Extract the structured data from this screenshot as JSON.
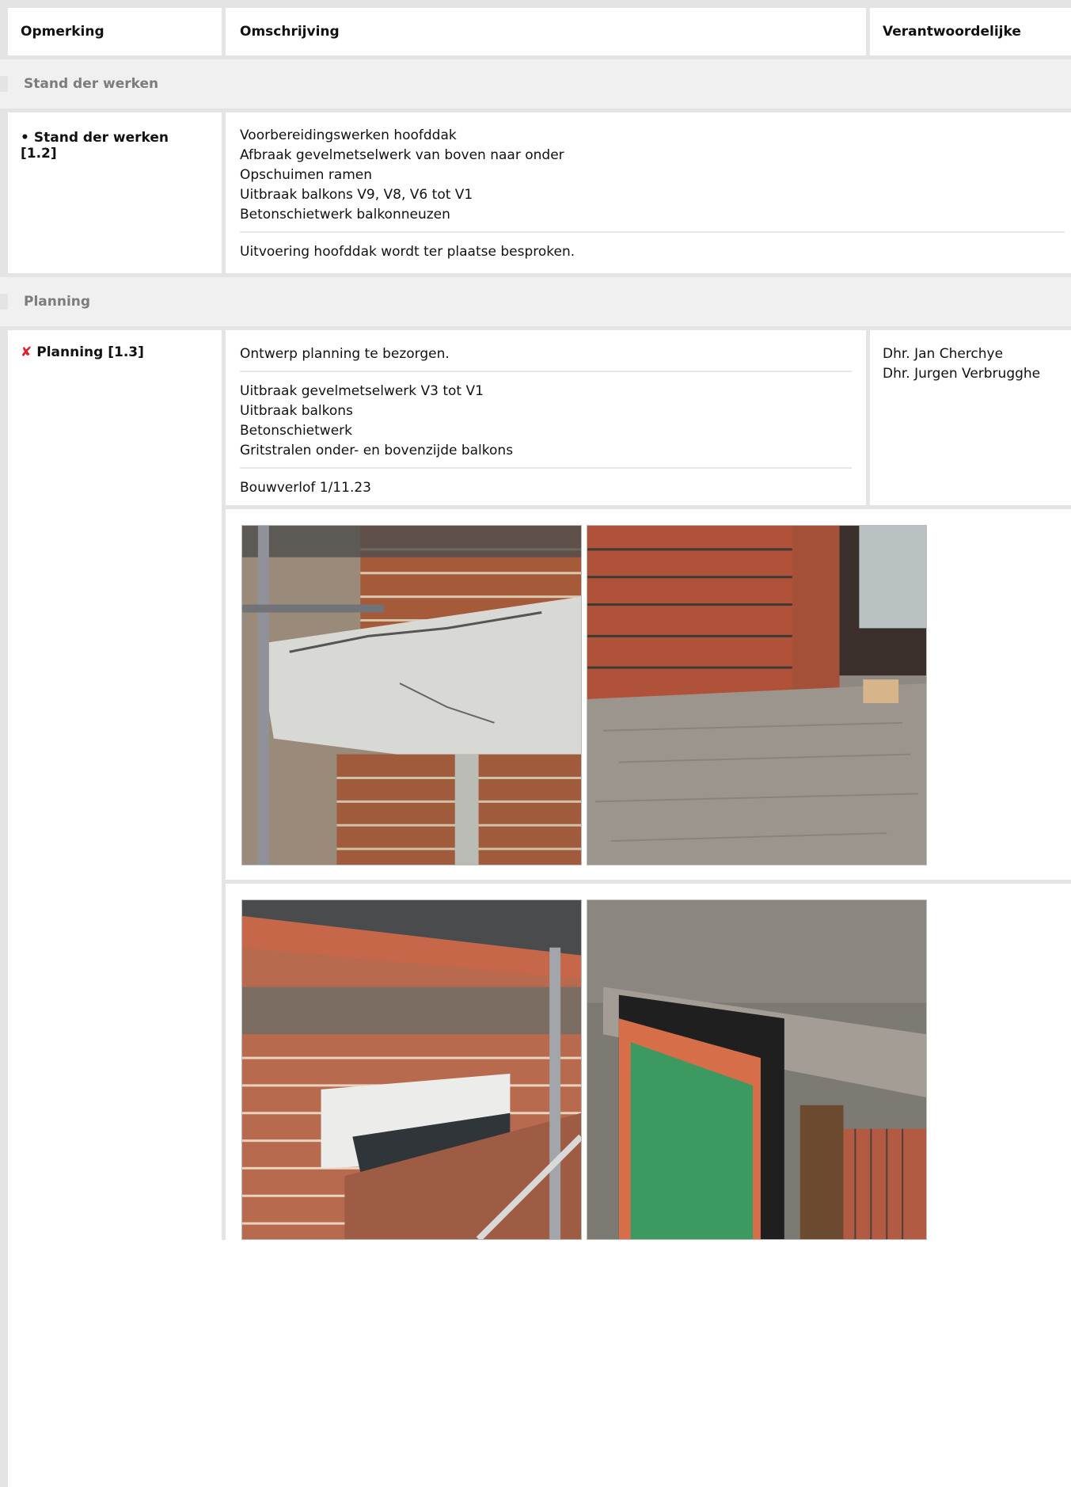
{
  "table": {
    "headers": {
      "opmerking": "Opmerking",
      "omschrijving": "Omschrijving",
      "verantwoordelijke": "Verantwoordelijke"
    }
  },
  "sections": [
    {
      "title": "Stand der werken",
      "item": {
        "bullet": "•",
        "label": "Stand der werken  [1.2]",
        "blocks": [
          [
            "Voorbereidingswerken hoofddak",
            "Afbraak gevelmetselwerk van boven naar onder",
            "Opschuimen ramen",
            "Uitbraak balkons V9, V8, V6 tot V1",
            "Betonschietwerk balkonneuzen"
          ],
          [
            "Uitvoering hoofddak wordt ter plaatse besproken."
          ]
        ]
      }
    },
    {
      "title": "Planning",
      "item": {
        "status_icon": "✘",
        "label": "Planning [1.3]",
        "blocks": [
          [
            "Ontwerp planning te bezorgen."
          ],
          [
            "Uitbraak gevelmetselwerk V3 tot V1",
            "Uitbraak balkons",
            "Betonschietwerk",
            "Gritstralen onder- en bovenzijde balkons"
          ],
          [
            "Bouwverlof 1/11.23"
          ]
        ],
        "responsible": [
          "Dhr. Jan Cherchye",
          "Dhr. Jurgen Verbrugghe"
        ]
      }
    }
  ],
  "photos": {
    "row1": [
      "photo-balcony-concrete-cracks",
      "photo-brick-wall-balcony-floor"
    ],
    "row2": [
      "photo-brick-facade-scaffolding",
      "photo-window-frame-plastic"
    ]
  },
  "colors": {
    "divider": "#e4e4e4",
    "section_bg": "#f0f0f0",
    "section_text": "#7c7c7c",
    "status_red": "#e0202a"
  }
}
